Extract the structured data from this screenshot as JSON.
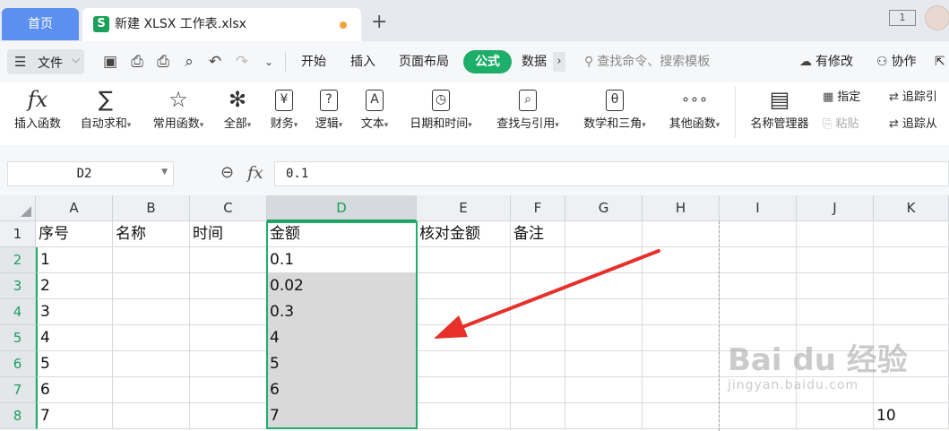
{
  "tabs": {
    "home": "首页",
    "doc_title": "新建 XLSX 工作表.xlsx",
    "new_tab": "+"
  },
  "window": {
    "tile_label": "1"
  },
  "toolbar": {
    "menu_label": "文件",
    "ribbon_tabs": [
      "开始",
      "插入",
      "页面布局",
      "公式",
      "数据"
    ],
    "active_tab": "公式",
    "search_placeholder": "查找命令、搜索模板",
    "changes_label": "有修改",
    "collab_label": "协作"
  },
  "ribbon": {
    "buttons": [
      {
        "label": "插入函数",
        "icon": "fx-icon",
        "glyph": "fx"
      },
      {
        "label": "自动求和",
        "icon": "sigma-icon",
        "glyph": "∑"
      },
      {
        "label": "常用函数",
        "icon": "star-icon",
        "glyph": "☆"
      },
      {
        "label": "全部",
        "icon": "asterisk-icon",
        "glyph": "✻"
      },
      {
        "label": "财务",
        "icon": "yen-icon",
        "glyph": "¥"
      },
      {
        "label": "逻辑",
        "icon": "question-icon",
        "glyph": "?"
      },
      {
        "label": "文本",
        "icon": "text-icon",
        "glyph": "A"
      },
      {
        "label": "日期和时间",
        "icon": "clock-icon",
        "glyph": "◷"
      },
      {
        "label": "查找与引用",
        "icon": "lookup-icon",
        "glyph": "⌕"
      },
      {
        "label": "数学和三角",
        "icon": "math-icon",
        "glyph": "θ"
      },
      {
        "label": "其他函数",
        "icon": "more-icon",
        "glyph": "∘∘∘"
      },
      {
        "label": "名称管理器",
        "icon": "name-manager-icon",
        "glyph": "▤"
      }
    ],
    "specify_label": "指定",
    "paste_label": "粘贴",
    "trace_precedents_label": "追踪引",
    "trace_dependents_label": "追踪从"
  },
  "formula_bar": {
    "name_box": "D2",
    "fx_label": "fx",
    "formula": "0.1"
  },
  "grid": {
    "columns": [
      "A",
      "B",
      "C",
      "D",
      "E",
      "F",
      "G",
      "H",
      "I",
      "J",
      "K"
    ],
    "rows": [
      "1",
      "2",
      "3",
      "4",
      "5",
      "6",
      "7",
      "8"
    ],
    "selected_column": "D",
    "cells": {
      "A1": "序号",
      "B1": "名称",
      "C1": "时间",
      "D1": "金额",
      "E1": "核对金额",
      "F1": "备注",
      "A2": "1",
      "D2": "0.1",
      "A3": "2",
      "D3": "0.02",
      "A4": "3",
      "D4": "0.3",
      "A5": "4",
      "D5": "4",
      "A6": "5",
      "D6": "5",
      "A7": "6",
      "D7": "6",
      "A8": "7",
      "D8": "7",
      "K8": "10"
    }
  },
  "watermark": {
    "line1": "Bai du 经验",
    "line2": "jingyan.baidu.com"
  },
  "colors": {
    "accent_green": "#1dae6a",
    "home_tab_blue": "#5b8ff0",
    "arrow_red": "#e8302a",
    "selection_fill": "#d9d9d9"
  }
}
